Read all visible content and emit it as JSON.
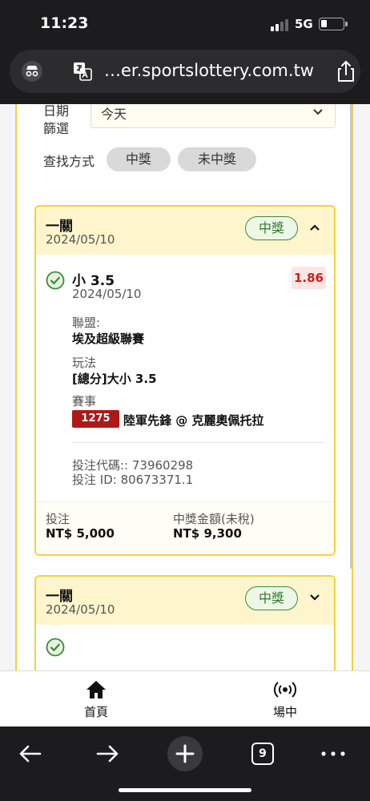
{
  "status_bar": {
    "time": "11:23",
    "network": "5G"
  },
  "browser": {
    "url": "…er.sportslottery.com.tw",
    "tabs_count": "9"
  },
  "filters": {
    "date_label": "日期篩選",
    "date_value": "今天",
    "search_label": "查找方式",
    "options": [
      "中獎",
      "未中獎"
    ]
  },
  "cards": [
    {
      "title": "一關",
      "date": "2024/05/10",
      "status": "中獎",
      "expanded": true,
      "selection": {
        "name": "小 3.5",
        "date": "2024/05/10",
        "odds": "1.86"
      },
      "league_label": "聯盟:",
      "league": "埃及超級聯賽",
      "market_label": "玩法",
      "market": "[總分]大小 3.5",
      "event_label": "賽事",
      "event_code": "1275",
      "event_name": "陸軍先鋒 @ 克麗奧佩托拉",
      "bet_code_line": "投注代碼:: 73960298",
      "bet_id_line": "投注 ID: 80673371.1",
      "stake_label": "投注",
      "stake": "NT$ 5,000",
      "payout_label": "中獎金額(未稅)",
      "payout": "NT$ 9,300"
    },
    {
      "title": "一關",
      "date": "2024/05/10",
      "status": "中獎",
      "expanded": false
    }
  ],
  "bottom_nav": [
    {
      "label": "首頁",
      "icon": "home-icon"
    },
    {
      "label": "場中",
      "icon": "live-broadcast-icon"
    }
  ],
  "colors": {
    "accent_yellow": "#f6d23b",
    "win_green": "#2d7a2d",
    "odds_red": "#c62020",
    "event_red": "#b01818"
  }
}
